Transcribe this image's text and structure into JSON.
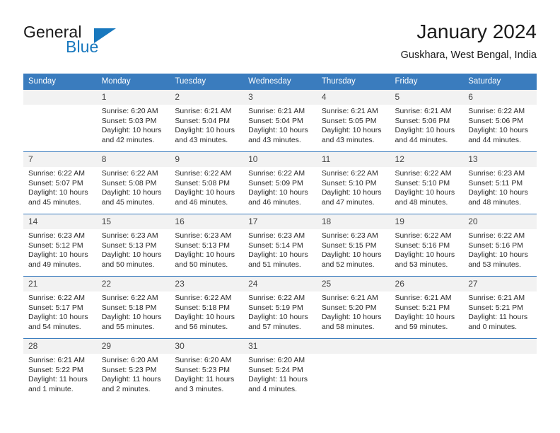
{
  "brand": {
    "name_part1": "General",
    "name_part2": "Blue",
    "accent_color": "#1878be",
    "triangle_icon": "brand-triangle-icon"
  },
  "header": {
    "title": "January 2024",
    "subtitle": "Guskhara, West Bengal, India"
  },
  "calendar": {
    "header_bg": "#3a7cbe",
    "daynum_bg": "#f2f2f2",
    "weekday_headers": [
      "Sunday",
      "Monday",
      "Tuesday",
      "Wednesday",
      "Thursday",
      "Friday",
      "Saturday"
    ],
    "weeks": [
      {
        "days": [
          {
            "num": "",
            "empty": true,
            "sunrise": "",
            "sunset": "",
            "daylight": ""
          },
          {
            "num": "1",
            "sunrise": "Sunrise: 6:20 AM",
            "sunset": "Sunset: 5:03 PM",
            "daylight": "Daylight: 10 hours and 42 minutes."
          },
          {
            "num": "2",
            "sunrise": "Sunrise: 6:21 AM",
            "sunset": "Sunset: 5:04 PM",
            "daylight": "Daylight: 10 hours and 43 minutes."
          },
          {
            "num": "3",
            "sunrise": "Sunrise: 6:21 AM",
            "sunset": "Sunset: 5:04 PM",
            "daylight": "Daylight: 10 hours and 43 minutes."
          },
          {
            "num": "4",
            "sunrise": "Sunrise: 6:21 AM",
            "sunset": "Sunset: 5:05 PM",
            "daylight": "Daylight: 10 hours and 43 minutes."
          },
          {
            "num": "5",
            "sunrise": "Sunrise: 6:21 AM",
            "sunset": "Sunset: 5:06 PM",
            "daylight": "Daylight: 10 hours and 44 minutes."
          },
          {
            "num": "6",
            "sunrise": "Sunrise: 6:22 AM",
            "sunset": "Sunset: 5:06 PM",
            "daylight": "Daylight: 10 hours and 44 minutes."
          }
        ]
      },
      {
        "days": [
          {
            "num": "7",
            "sunrise": "Sunrise: 6:22 AM",
            "sunset": "Sunset: 5:07 PM",
            "daylight": "Daylight: 10 hours and 45 minutes."
          },
          {
            "num": "8",
            "sunrise": "Sunrise: 6:22 AM",
            "sunset": "Sunset: 5:08 PM",
            "daylight": "Daylight: 10 hours and 45 minutes."
          },
          {
            "num": "9",
            "sunrise": "Sunrise: 6:22 AM",
            "sunset": "Sunset: 5:08 PM",
            "daylight": "Daylight: 10 hours and 46 minutes."
          },
          {
            "num": "10",
            "sunrise": "Sunrise: 6:22 AM",
            "sunset": "Sunset: 5:09 PM",
            "daylight": "Daylight: 10 hours and 46 minutes."
          },
          {
            "num": "11",
            "sunrise": "Sunrise: 6:22 AM",
            "sunset": "Sunset: 5:10 PM",
            "daylight": "Daylight: 10 hours and 47 minutes."
          },
          {
            "num": "12",
            "sunrise": "Sunrise: 6:22 AM",
            "sunset": "Sunset: 5:10 PM",
            "daylight": "Daylight: 10 hours and 48 minutes."
          },
          {
            "num": "13",
            "sunrise": "Sunrise: 6:23 AM",
            "sunset": "Sunset: 5:11 PM",
            "daylight": "Daylight: 10 hours and 48 minutes."
          }
        ]
      },
      {
        "days": [
          {
            "num": "14",
            "sunrise": "Sunrise: 6:23 AM",
            "sunset": "Sunset: 5:12 PM",
            "daylight": "Daylight: 10 hours and 49 minutes."
          },
          {
            "num": "15",
            "sunrise": "Sunrise: 6:23 AM",
            "sunset": "Sunset: 5:13 PM",
            "daylight": "Daylight: 10 hours and 50 minutes."
          },
          {
            "num": "16",
            "sunrise": "Sunrise: 6:23 AM",
            "sunset": "Sunset: 5:13 PM",
            "daylight": "Daylight: 10 hours and 50 minutes."
          },
          {
            "num": "17",
            "sunrise": "Sunrise: 6:23 AM",
            "sunset": "Sunset: 5:14 PM",
            "daylight": "Daylight: 10 hours and 51 minutes."
          },
          {
            "num": "18",
            "sunrise": "Sunrise: 6:23 AM",
            "sunset": "Sunset: 5:15 PM",
            "daylight": "Daylight: 10 hours and 52 minutes."
          },
          {
            "num": "19",
            "sunrise": "Sunrise: 6:22 AM",
            "sunset": "Sunset: 5:16 PM",
            "daylight": "Daylight: 10 hours and 53 minutes."
          },
          {
            "num": "20",
            "sunrise": "Sunrise: 6:22 AM",
            "sunset": "Sunset: 5:16 PM",
            "daylight": "Daylight: 10 hours and 53 minutes."
          }
        ]
      },
      {
        "days": [
          {
            "num": "21",
            "sunrise": "Sunrise: 6:22 AM",
            "sunset": "Sunset: 5:17 PM",
            "daylight": "Daylight: 10 hours and 54 minutes."
          },
          {
            "num": "22",
            "sunrise": "Sunrise: 6:22 AM",
            "sunset": "Sunset: 5:18 PM",
            "daylight": "Daylight: 10 hours and 55 minutes."
          },
          {
            "num": "23",
            "sunrise": "Sunrise: 6:22 AM",
            "sunset": "Sunset: 5:18 PM",
            "daylight": "Daylight: 10 hours and 56 minutes."
          },
          {
            "num": "24",
            "sunrise": "Sunrise: 6:22 AM",
            "sunset": "Sunset: 5:19 PM",
            "daylight": "Daylight: 10 hours and 57 minutes."
          },
          {
            "num": "25",
            "sunrise": "Sunrise: 6:21 AM",
            "sunset": "Sunset: 5:20 PM",
            "daylight": "Daylight: 10 hours and 58 minutes."
          },
          {
            "num": "26",
            "sunrise": "Sunrise: 6:21 AM",
            "sunset": "Sunset: 5:21 PM",
            "daylight": "Daylight: 10 hours and 59 minutes."
          },
          {
            "num": "27",
            "sunrise": "Sunrise: 6:21 AM",
            "sunset": "Sunset: 5:21 PM",
            "daylight": "Daylight: 11 hours and 0 minutes."
          }
        ]
      },
      {
        "days": [
          {
            "num": "28",
            "sunrise": "Sunrise: 6:21 AM",
            "sunset": "Sunset: 5:22 PM",
            "daylight": "Daylight: 11 hours and 1 minute."
          },
          {
            "num": "29",
            "sunrise": "Sunrise: 6:20 AM",
            "sunset": "Sunset: 5:23 PM",
            "daylight": "Daylight: 11 hours and 2 minutes."
          },
          {
            "num": "30",
            "sunrise": "Sunrise: 6:20 AM",
            "sunset": "Sunset: 5:23 PM",
            "daylight": "Daylight: 11 hours and 3 minutes."
          },
          {
            "num": "31",
            "sunrise": "Sunrise: 6:20 AM",
            "sunset": "Sunset: 5:24 PM",
            "daylight": "Daylight: 11 hours and 4 minutes."
          },
          {
            "num": "",
            "empty": true,
            "sunrise": "",
            "sunset": "",
            "daylight": ""
          },
          {
            "num": "",
            "empty": true,
            "sunrise": "",
            "sunset": "",
            "daylight": ""
          },
          {
            "num": "",
            "empty": true,
            "sunrise": "",
            "sunset": "",
            "daylight": ""
          }
        ]
      }
    ]
  }
}
